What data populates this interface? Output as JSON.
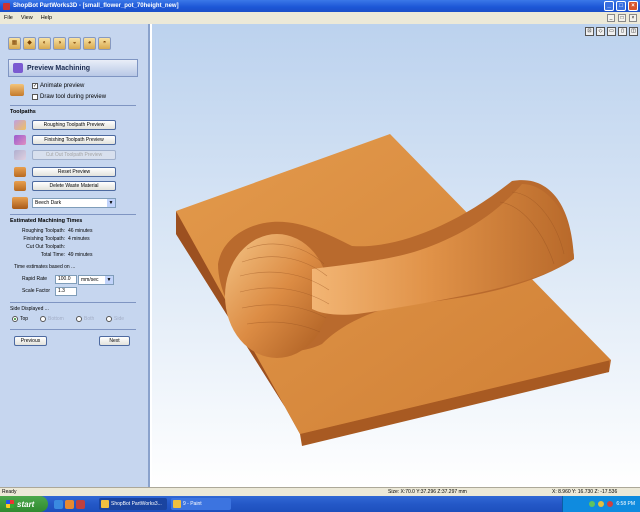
{
  "window": {
    "title": "ShopBot PartWorks3D - [small_flower_pot_70height_new]",
    "minimize": "_",
    "maximize": "□",
    "close": "×"
  },
  "menu": {
    "items": [
      "File",
      "View",
      "Help"
    ],
    "doc_controls": [
      "_",
      "□",
      "×"
    ]
  },
  "panel": {
    "section_title": "Preview Machining",
    "animate_preview": {
      "label": "Animate preview",
      "checked": true
    },
    "draw_tool": {
      "label": "Draw tool during preview",
      "checked": false
    },
    "toolpaths_header": "Toolpaths",
    "buttons": {
      "roughing": "Roughing Toolpath Preview",
      "finishing": "Finishing Toolpath Preview",
      "cutout": "Cut Out Toolpath Preview",
      "reset": "Reset Preview",
      "delete_waste": "Delete Waste Material"
    },
    "material": "Beech Dark",
    "est_header": "Estimated Machining Times",
    "times": [
      {
        "label": "Roughing Toolpath:",
        "value": "46 minutes"
      },
      {
        "label": "Finishing Toolpath:",
        "value": "4 minutes"
      },
      {
        "label": "Cut Out Toolpath:",
        "value": ""
      },
      {
        "label": "Total Time:",
        "value": "49 minutes"
      }
    ],
    "based_on": "Time estimates based on ...",
    "rapid_rate_label": "Rapid Rate",
    "rapid_rate_value": "100.0",
    "rapid_unit": "mm/sec",
    "scale_factor_label": "Scale Factor",
    "scale_factor_value": "1.3",
    "side_header": "Side Displayed ...",
    "sides": [
      "Top",
      "Bottom",
      "Both",
      "Side"
    ],
    "prev": "Previous",
    "next": "Next"
  },
  "status": {
    "left": "Ready",
    "size": "Size: X:70.0 Y:37.296 Z:37.297 mm",
    "coords": "X: 8.960 Y: 16.730 Z: -17.536"
  },
  "taskbar": {
    "start": "start",
    "tasks": [
      "ShopBot PartWorks3...",
      "9 - Paint"
    ],
    "clock": "6:58 PM"
  },
  "colors": {
    "accent": "#1c56d6",
    "panel": "#c6d6ef",
    "wood": "#d98a3c"
  }
}
